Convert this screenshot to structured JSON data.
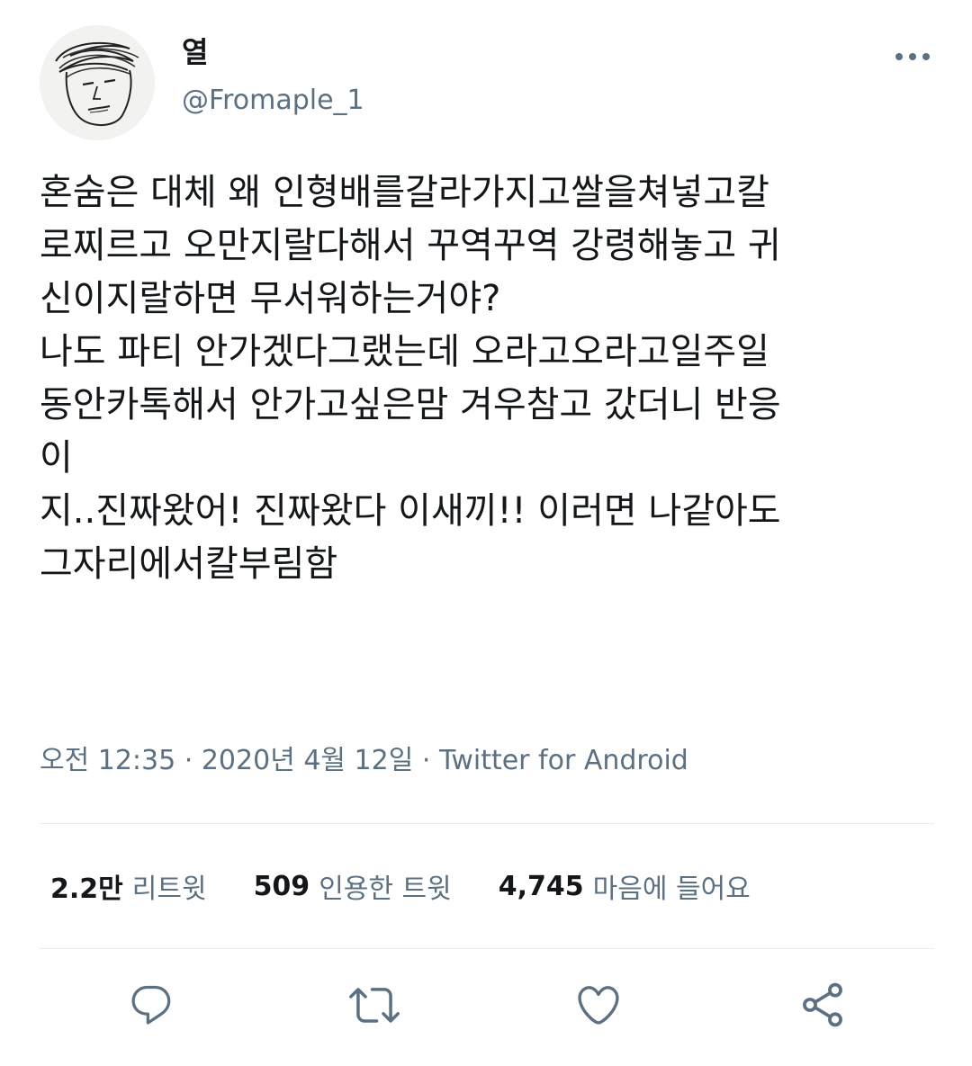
{
  "user": {
    "display_name": "열",
    "handle": "@Fromaple_1",
    "avatar_icon": "hand-drawn-face-avatar"
  },
  "tweet": {
    "text": "혼숨은 대체 왜 인형배를갈라가지고쌀을쳐넣고칼\n로찌르고 오만지랄다해서 꾸역꾸역 강령해놓고 귀\n신이지랄하면 무서워하는거야?\n나도 파티 안가겠다그랬는데 오라고오라고일주일\n동안카톡해서 안가고싶은맘 겨우참고 갔더니 반응\n이\n지..진짜왔어! 진짜왔다 이새끼!! 이러면 나같아도\n그자리에서칼부림함"
  },
  "meta": {
    "time": "오전 12:35",
    "separator": "·",
    "date": "2020년 4월 12일",
    "source": "Twitter for Android"
  },
  "stats": {
    "retweets_count": "2.2만",
    "retweets_label": "리트윗",
    "quotes_count": "509",
    "quotes_label": "인용한 트윗",
    "likes_count": "4,745",
    "likes_label": "마음에 들어요"
  },
  "actions": {
    "reply_icon": "speech-bubble-icon",
    "retweet_icon": "retweet-arrows-icon",
    "like_icon": "heart-icon",
    "share_icon": "share-nodes-icon"
  },
  "colors": {
    "text_primary": "#14171a",
    "text_secondary": "#5b7083",
    "divider": "#e6ecf0",
    "icon": "#5b7083"
  }
}
